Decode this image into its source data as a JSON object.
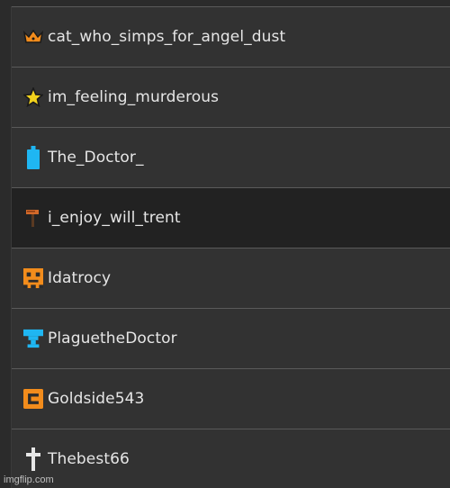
{
  "users": [
    {
      "name": "cat_who_simps_for_angel_dust",
      "icon": "crown-icon",
      "color": "#f28c1c"
    },
    {
      "name": "im_feeling_murderous",
      "icon": "star-icon",
      "color": "#f2d21c"
    },
    {
      "name": "The_Doctor_",
      "icon": "phone-box-icon",
      "color": "#1fb6f2"
    },
    {
      "name": "i_enjoy_will_trent",
      "icon": "hammer-icon",
      "color": "#d2692a"
    },
    {
      "name": "Idatrocy",
      "icon": "pixel-face-icon",
      "color": "#f28c1c"
    },
    {
      "name": "PlaguetheDoctor",
      "icon": "trophy-icon",
      "color": "#1fb6f2"
    },
    {
      "name": "Goldside543",
      "icon": "c-block-icon",
      "color": "#f28c1c"
    },
    {
      "name": "Thebest66",
      "icon": "cross-icon",
      "color": "#e6e6e6"
    }
  ],
  "selected_index": 3,
  "watermark": "imgflip.com"
}
